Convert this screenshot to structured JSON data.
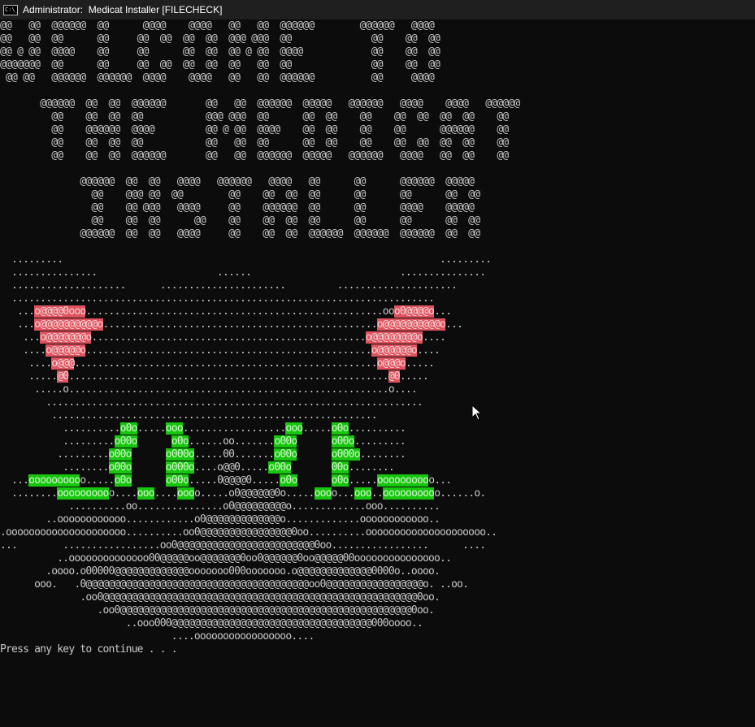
{
  "window": {
    "title": "Administrator:  Medicat Installer [FILECHECK]",
    "icon": "cmd-icon",
    "icon_text": "C:\\_"
  },
  "colors": {
    "background": "#0c0c0c",
    "text": "#c8c8c8",
    "heart": "#e0535e",
    "eye": "#16c60c"
  },
  "console": {
    "lines": [
      "@@   @@  @@@@@@  @@      @@@@    @@@@   @@   @@  @@@@@@        @@@@@@   @@@@",
      "@@   @@  @@      @@     @@  @@  @@  @@  @@@ @@@  @@              @@    @@  @@",
      "@@ @ @@  @@@@    @@     @@      @@  @@  @@ @ @@  @@@@            @@    @@  @@",
      "@@@@@@@  @@      @@     @@  @@  @@  @@  @@   @@  @@              @@    @@  @@",
      " @@ @@   @@@@@@  @@@@@@  @@@@    @@@@   @@   @@  @@@@@@          @@     @@@@",
      "",
      "       @@@@@@  @@  @@  @@@@@@       @@   @@  @@@@@@  @@@@@   @@@@@@   @@@@    @@@@   @@@@@@",
      "         @@    @@  @@  @@           @@@ @@@  @@      @@  @@    @@    @@  @@  @@  @@    @@",
      "         @@    @@@@@@  @@@@         @@ @ @@  @@@@    @@  @@    @@    @@      @@@@@@    @@",
      "         @@    @@  @@  @@           @@   @@  @@      @@  @@    @@    @@  @@  @@  @@    @@",
      "         @@    @@  @@  @@@@@@       @@   @@  @@@@@@  @@@@@   @@@@@@   @@@@   @@  @@    @@",
      "",
      "              @@@@@@  @@  @@   @@@@   @@@@@@   @@@@   @@      @@      @@@@@@  @@@@@",
      "                @@    @@@ @@  @@        @@    @@  @@  @@      @@      @@      @@  @@",
      "                @@    @@ @@@   @@@@     @@    @@@@@@  @@      @@      @@@@    @@@@@",
      "                @@    @@  @@      @@    @@    @@  @@  @@      @@      @@      @@  @@",
      "              @@@@@@  @@  @@   @@@@     @@    @@  @@  @@@@@@  @@@@@@  @@@@@@  @@  @@",
      "",
      "  .........                                                                  .........",
      "  ...............                     ......                          ...............",
      "  ....................      ......................         .....................",
      "  ..........................................................................",
      "   ...o@@@@0ooo....................................................ooo0@@@@o...",
      "   ...o@@@@@@@@@@o................................................o@@@@@@@@@@o...",
      "    ...o@@@@@@@o................................................o@@@@@@@@o....",
      "    ....o@@@@@o..................................................o@@@@@@o....",
      "     ....o@@@.....................................................o@@@o.....",
      "     .....@0........................................................@0.....",
      "      .....o........................................................o....",
      "        ..................................................................",
      "         .........................................................",
      "           ..........o0o.....ooo..................ooo.....o0o..........",
      "           .........o00o      o0o......oo.......o00o      o00o.........",
      "          .........o00o      o000o.....00.......o00o      o000o........",
      "           ........o00o      o000o....o@@0.....o00o       00o........",
      "  ...oooooooooo.....o0o      o00o.....0@@@@0.....o0o      o0o.....oooooooooo...",
      "  ........oooooooooo....ooo....oooo.....o0@@@@@@0o.....oooo...ooo..oooooooooo......o.",
      "            ..........oo...............o0@@@@@@@@@o.............ooo..........",
      "        ..oooooooooooo............o0@@@@@@@@@@@@@o.............oooooooooooo..",
      ".ooooooooooooooooooooo..........oo0@@@@@@@@@@@@@@@@0oo..........ooooooooooooooooooooo..",
      "...        .................oo0@@@@@@@@@@@@@@@@@@@@@@@@0oo.................      ....",
      "          ..oooooooooooooo00@@@@@oo@@@@@@@0oo0@@@@@@0oo@@@@@00ooooooooooooooo..",
      "        .oooo.o00000@@@@@@@@@@@@@ooooooo000ooooooo.o@@@@@@@@@@@@@0000o..oooo.",
      "      ooo.   .0@@@@@@@@@@@@@@@@@@@@@@@@@@@@@@@@@@@@@@@oo0@@@@@@@@@@@@@@@@@o. ..oo.",
      "              .oo0@@@@@@@@@@@@@@@@@@@@@@@@@@@@@@@@@@@@@@@@@@@@@@@@@@@@@@@0oo.",
      "                 .oo0@@@@@@@@@@@@@@@@@@@@@@@@@@@@@@@@@@@@@@@@@@@@@@@@@@@0oo.",
      "                      ..ooo000@@@@@@@@@@@@@@@@@@@@@@@@@@@@@@@@@@@000oooo..",
      "                              ....ooooooooooooooooo....",
      "Press any key to continue . . ."
    ],
    "heart_left_fill": "o@@@@@@@@@@o",
    "eye_fill": "o00o"
  }
}
